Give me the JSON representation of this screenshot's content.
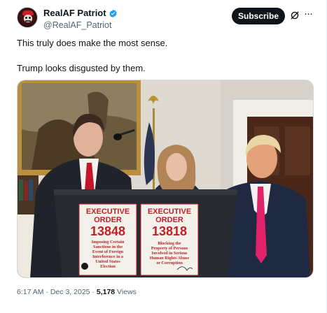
{
  "author": {
    "display_name": "RealAF Patriot",
    "handle": "@RealAF_Patriot",
    "verified": true,
    "verified_color": "#1d9bf0"
  },
  "actions": {
    "subscribe_label": "Subscribe"
  },
  "post": {
    "text_line1": "This truly does make the most sense.",
    "text_line2": "Trump looks disgusted by them."
  },
  "media": {
    "sign_left": {
      "title_line1": "EXECUTIVE",
      "title_line2": "ORDER",
      "number": "13848",
      "body": [
        "Imposing Certain",
        "Sanctions in the",
        "Event of Foreign",
        "Interference in a",
        "United States",
        "Election"
      ]
    },
    "sign_right": {
      "title_line1": "EXECUTIVE",
      "title_line2": "ORDER",
      "number": "13818",
      "body": [
        "Blocking the",
        "Property of Persons",
        "Involved in Serious",
        "Human Rights Abuse",
        "or Corruption"
      ]
    },
    "sign_red": "#c0202a"
  },
  "meta": {
    "time": "6:17 AM",
    "separator": "·",
    "date": "Dec 3, 2025",
    "views_count": "5,178",
    "views_label": "Views"
  }
}
